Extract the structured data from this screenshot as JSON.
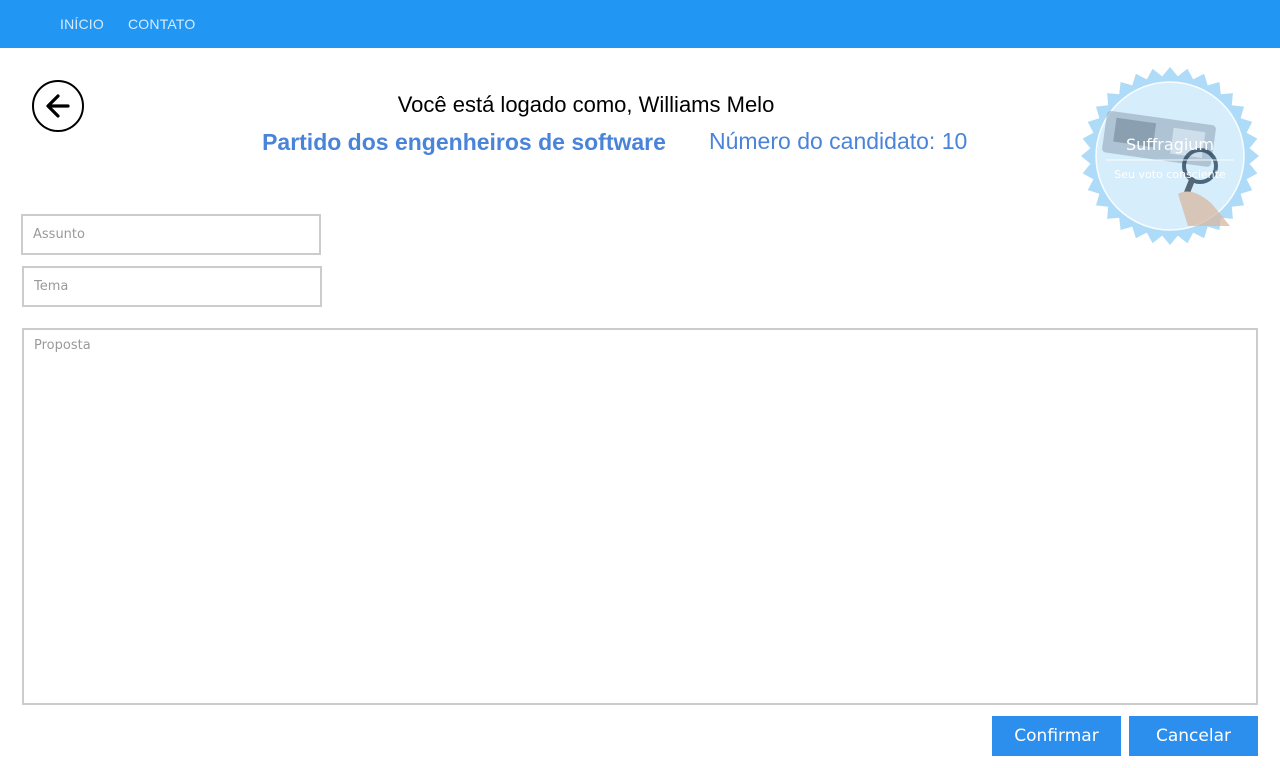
{
  "nav": {
    "items": [
      {
        "label": "INÍCIO"
      },
      {
        "label": "CONTATO"
      }
    ]
  },
  "header": {
    "back_icon": "arrow-left-icon",
    "logged_as": "Você está logado como, Williams Melo",
    "party": "Partido dos engenheiros de software",
    "candidate_number": "Número do candidato: 10"
  },
  "logo": {
    "title": "Suffragium",
    "subtitle": "Seu voto consciente"
  },
  "form": {
    "subject_placeholder": "Assunto",
    "theme_placeholder": "Tema",
    "proposal_placeholder": "Proposta"
  },
  "actions": {
    "confirm_label": "Confirmar",
    "cancel_label": "Cancelar"
  },
  "colors": {
    "navbar": "#2196f3",
    "accent_text": "#4a84d9",
    "button": "#2d8fed"
  }
}
